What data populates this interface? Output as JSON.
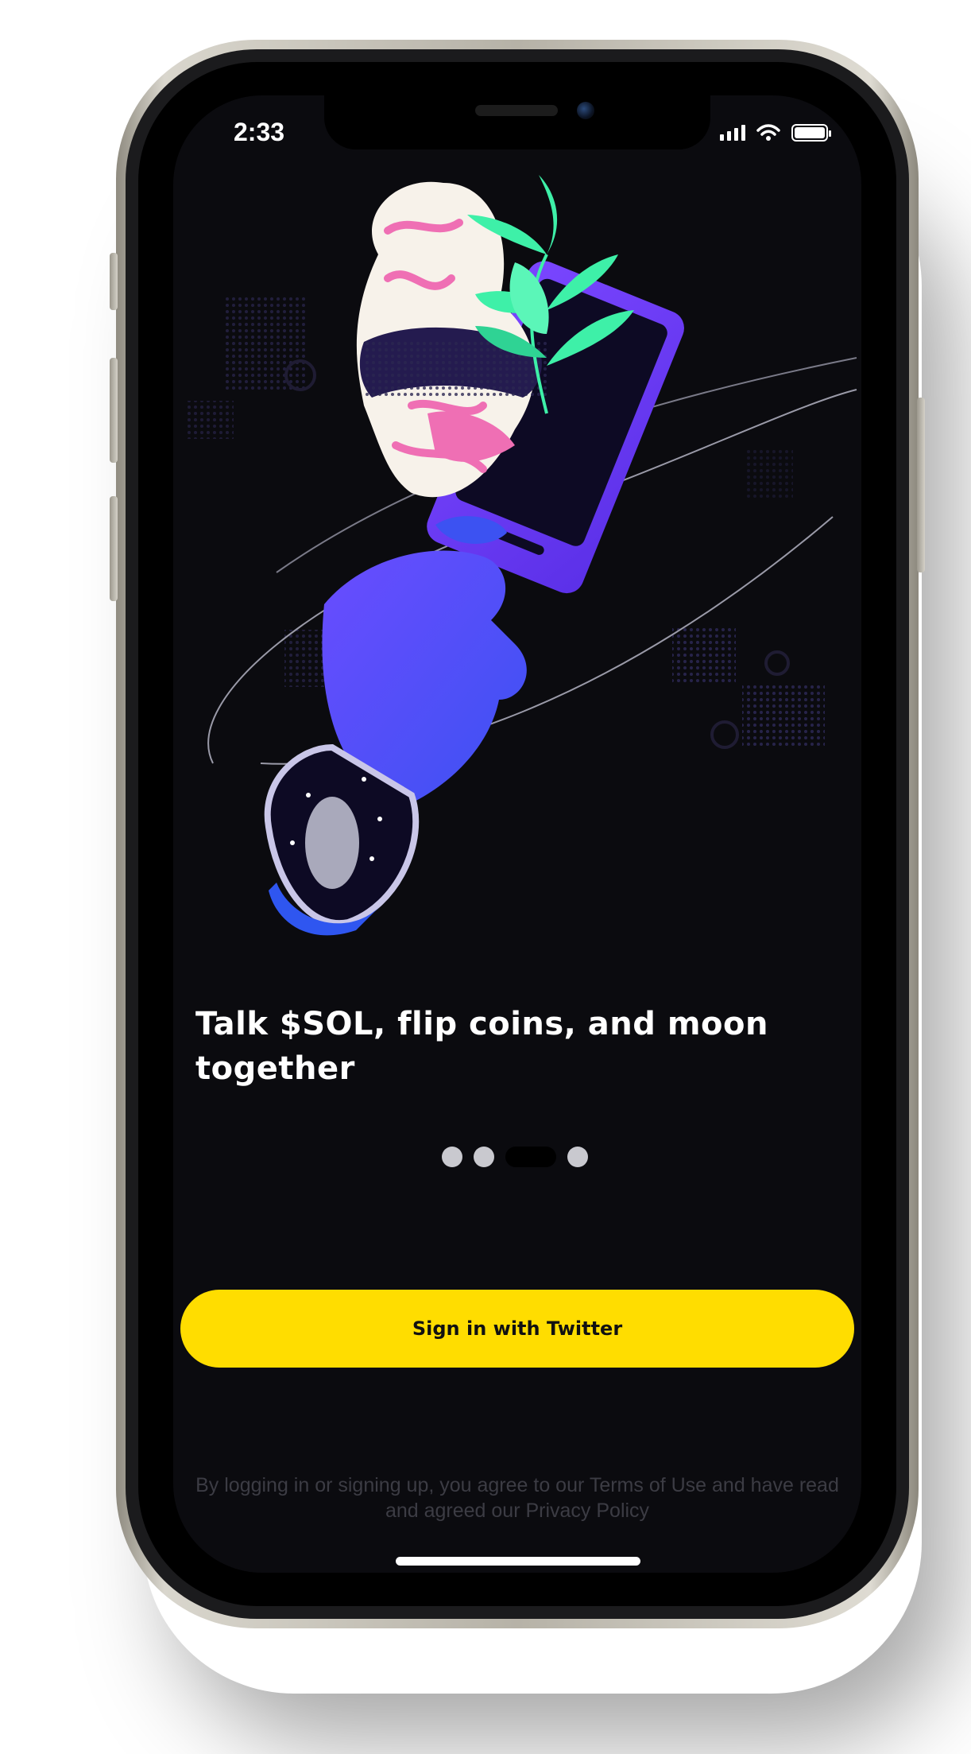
{
  "status_bar": {
    "time": "2:33"
  },
  "onboarding": {
    "headline": "Talk $SOL, flip coins, and moon together",
    "page_indicator": {
      "count": 4,
      "active_index": 2
    }
  },
  "actions": {
    "sign_in_label": "Sign in with Twitter"
  },
  "legal": {
    "text": "By logging in or signing up, you agree to our Terms of Use and have read and agreed our Privacy Policy"
  },
  "colors": {
    "screen_background": "#0b0b0f",
    "cta_background": "#ffdd00",
    "headline_text": "#ffffff",
    "legal_text": "#3c3c44",
    "illustration_primary": "#5b3df5",
    "illustration_leaf": "#3ef0a8",
    "illustration_pink": "#ef6fb4"
  },
  "icons": [
    "cellular-signal-icon",
    "wifi-icon",
    "battery-icon"
  ]
}
